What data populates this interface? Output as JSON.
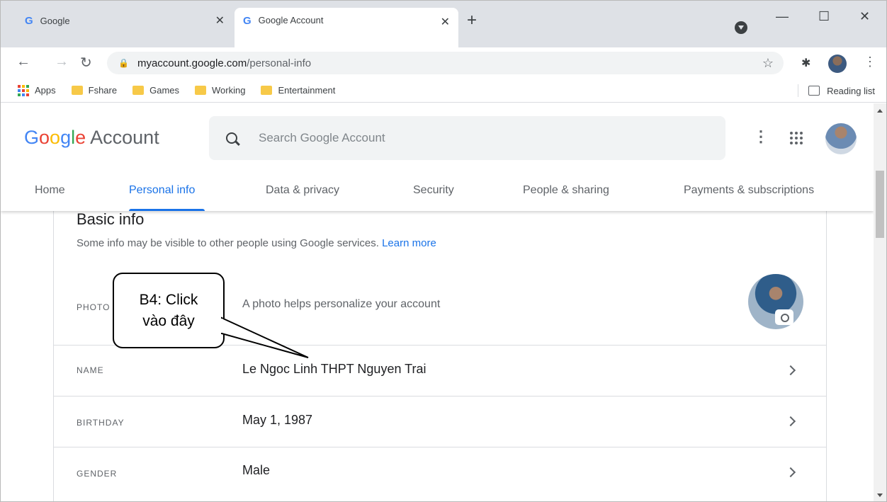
{
  "browser": {
    "tabs": [
      {
        "icon": "G",
        "title": "Google",
        "close": "✕"
      },
      {
        "icon": "G",
        "title": "Google Account",
        "close": "✕"
      }
    ],
    "new_tab": "+",
    "window_controls": {
      "minimize": "—",
      "maximize": "☐",
      "close": "✕"
    },
    "url": {
      "host": "myaccount.google.com",
      "path": "/personal-info"
    },
    "bookmarks": [
      {
        "label": "Apps",
        "icon": "apps-grid-icon"
      },
      {
        "label": "Fshare",
        "icon": "folder-icon"
      },
      {
        "label": "Games",
        "icon": "folder-icon"
      },
      {
        "label": "Working",
        "icon": "folder-icon"
      },
      {
        "label": "Entertainment",
        "icon": "folder-icon"
      }
    ],
    "reading_list": "Reading list"
  },
  "header": {
    "logo_letters": [
      "G",
      "o",
      "o",
      "g",
      "l",
      "e"
    ],
    "logo_suffix": "Account",
    "search_placeholder": "Search Google Account"
  },
  "nav": {
    "items": [
      "Home",
      "Personal info",
      "Data & privacy",
      "Security",
      "People & sharing",
      "Payments & subscriptions"
    ],
    "active": "Personal info"
  },
  "basic_info": {
    "title": "Basic info",
    "description": "Some info may be visible to other people using Google services.",
    "learn_more": "Learn more",
    "rows": [
      {
        "label": "PHOTO",
        "value": "A photo helps personalize your account"
      },
      {
        "label": "NAME",
        "value": "Le Ngoc Linh THPT Nguyen Trai"
      },
      {
        "label": "BIRTHDAY",
        "value": "May 1, 1987"
      },
      {
        "label": "GENDER",
        "value": "Male"
      }
    ]
  },
  "annotation": {
    "line1": "B4: Click",
    "line2": "vào đây"
  },
  "colors": {
    "accent": "#1a73e8",
    "tab_strip": "#dee1e6",
    "folder": "#f7c948"
  }
}
